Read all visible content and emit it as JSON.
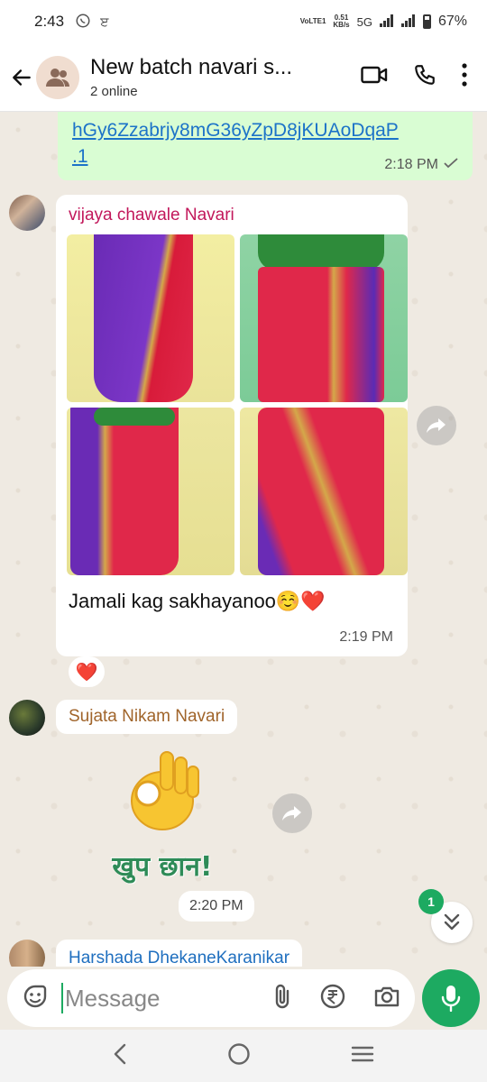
{
  "status_bar": {
    "time": "2:43",
    "net_speed": "0.51",
    "net_unit": "KB/s",
    "network": "5G",
    "volte": "VoLTE1",
    "battery": "67%"
  },
  "header": {
    "title": "New batch navari s...",
    "subtitle": "2 online"
  },
  "messages": {
    "outgoing_link": {
      "lines": [
        "hGy6Zzabrjy8mG36yZpD8jKUAoDqaP",
        ".1"
      ],
      "time": "2:18 PM"
    },
    "vijaya": {
      "sender": "vijaya chawale Navari",
      "caption": "Jamali kag sakhayanoo☺️❤️",
      "time": "2:19 PM",
      "reaction": "❤️"
    },
    "sujata": {
      "sender": "Sujata Nikam Navari",
      "sticker_text": "खुप छान!",
      "time": "2:20 PM"
    },
    "harshada": {
      "sender": "Harshada DhekaneKaranikar"
    }
  },
  "scroll": {
    "unread_count": "1"
  },
  "composer": {
    "placeholder": "Message"
  },
  "colors": {
    "accent": "#1daa61",
    "outgoing_bubble": "#d9fdd3",
    "chat_bg": "#efeae2"
  }
}
